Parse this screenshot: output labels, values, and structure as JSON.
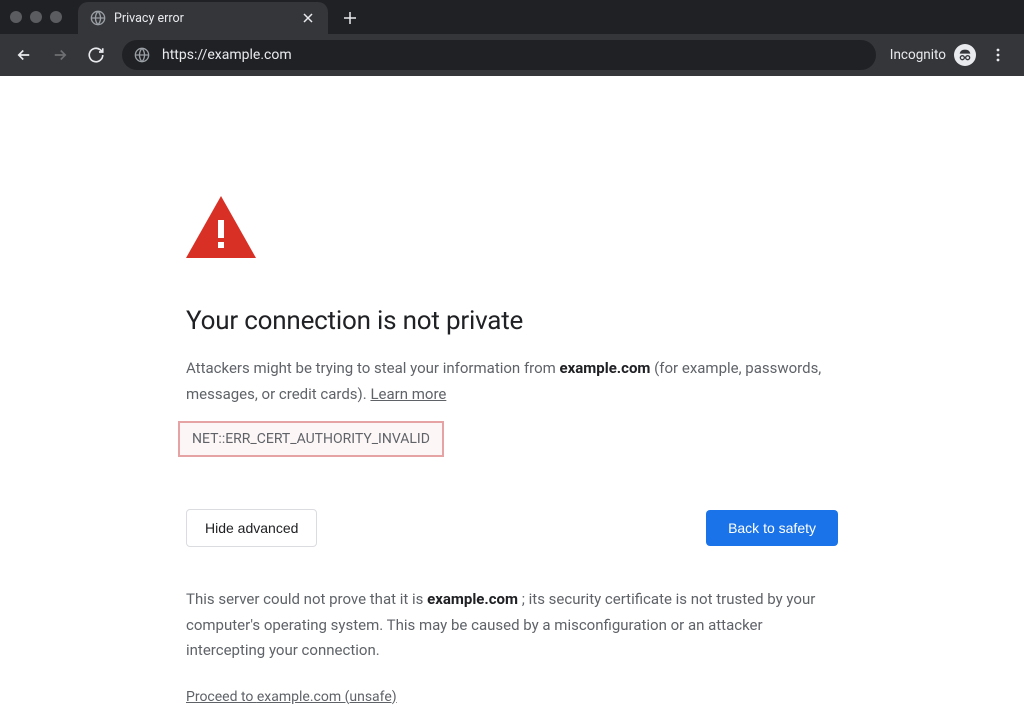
{
  "tab": {
    "title": "Privacy error"
  },
  "omnibox": {
    "url": "https://example.com"
  },
  "incognito": {
    "label": "Incognito"
  },
  "page": {
    "heading": "Your connection is not private",
    "warn_prefix": "Attackers might be trying to steal your information from ",
    "warn_domain": "example.com",
    "warn_suffix": " (for example, passwords, messages, or credit cards). ",
    "learn_more": "Learn more",
    "error_code": "NET::ERR_CERT_AUTHORITY_INVALID",
    "hide_advanced": "Hide advanced",
    "back_to_safety": "Back to safety",
    "details_prefix": "This server could not prove that it is ",
    "details_domain": "example.com",
    "details_suffix": " ; its security certificate is not trusted by your computer's operating system. This may be caused by a misconfiguration or an attacker intercepting your connection.",
    "proceed_prefix": "Proceed to ",
    "proceed_link_text": "example.com (unsafe)"
  }
}
